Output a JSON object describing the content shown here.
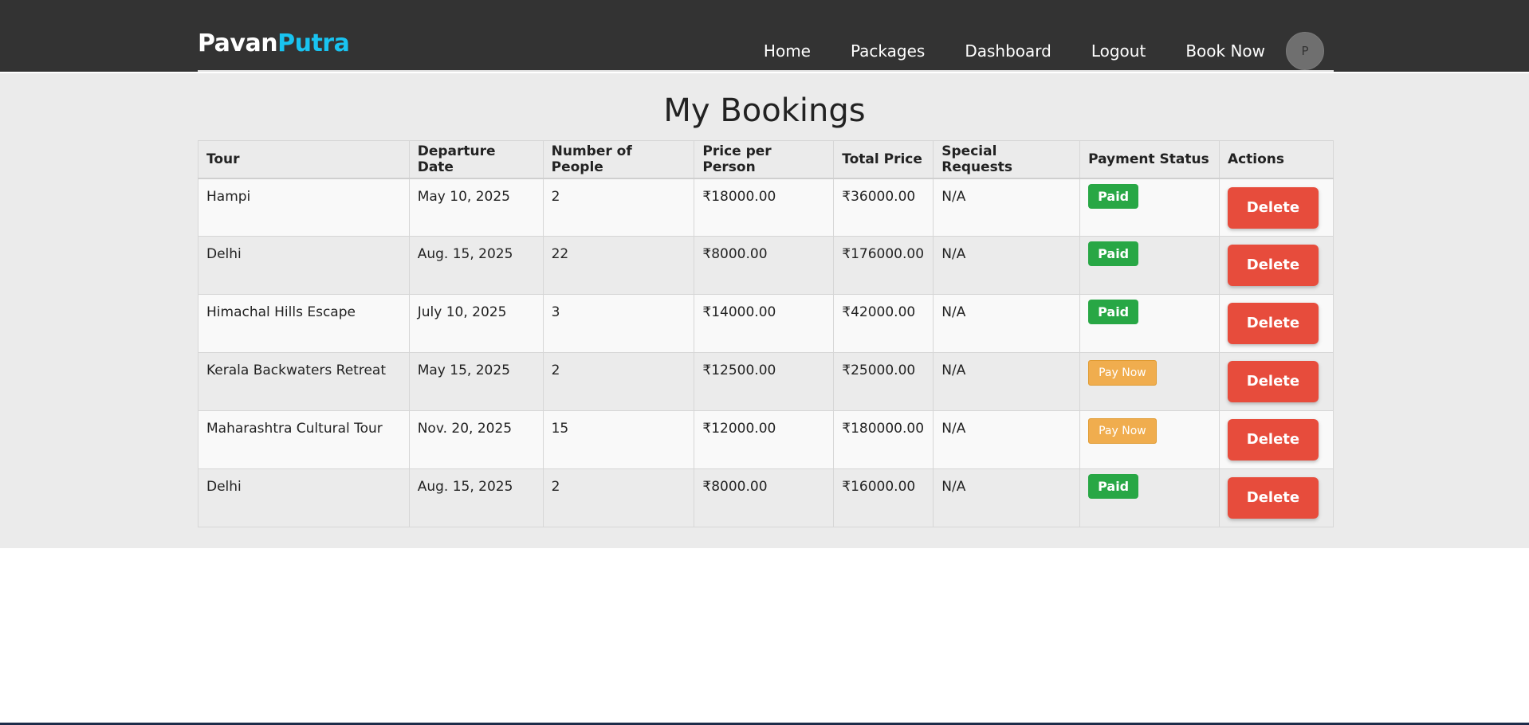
{
  "brand": {
    "part1": "Pavan",
    "part2": "Putra"
  },
  "nav": {
    "home": "Home",
    "packages": "Packages",
    "dashboard": "Dashboard",
    "logout": "Logout",
    "book_now": "Book Now",
    "avatar_initial": "P"
  },
  "page": {
    "title": "My Bookings"
  },
  "table": {
    "headers": [
      "Tour",
      "Departure Date",
      "Number of People",
      "Price per Person",
      "Total Price",
      "Special Requests",
      "Payment Status",
      "Actions"
    ],
    "rows": [
      {
        "tour": "Hampi",
        "date": "May 10, 2025",
        "people": "2",
        "price": "₹18000.00",
        "total": "₹36000.00",
        "requests": "N/A",
        "status": "Paid",
        "action": "Delete"
      },
      {
        "tour": "Delhi",
        "date": "Aug. 15, 2025",
        "people": "22",
        "price": "₹8000.00",
        "total": "₹176000.00",
        "requests": "N/A",
        "status": "Paid",
        "action": "Delete"
      },
      {
        "tour": "Himachal Hills Escape",
        "date": "July 10, 2025",
        "people": "3",
        "price": "₹14000.00",
        "total": "₹42000.00",
        "requests": "N/A",
        "status": "Paid",
        "action": "Delete"
      },
      {
        "tour": "Kerala Backwaters Retreat",
        "date": "May 15, 2025",
        "people": "2",
        "price": "₹12500.00",
        "total": "₹25000.00",
        "requests": "N/A",
        "status": "Pay Now",
        "action": "Delete"
      },
      {
        "tour": "Maharashtra Cultural Tour",
        "date": "Nov. 20, 2025",
        "people": "15",
        "price": "₹12000.00",
        "total": "₹180000.00",
        "requests": "N/A",
        "status": "Pay Now",
        "action": "Delete"
      },
      {
        "tour": "Delhi",
        "date": "Aug. 15, 2025",
        "people": "2",
        "price": "₹8000.00",
        "total": "₹16000.00",
        "requests": "N/A",
        "status": "Paid",
        "action": "Delete"
      }
    ]
  },
  "colors": {
    "navbar": "#333333",
    "brand_accent": "#19c3f0",
    "paid": "#28a745",
    "pay_now": "#f0ad4e",
    "delete": "#e74c3c",
    "content_bg": "#ebebeb"
  }
}
